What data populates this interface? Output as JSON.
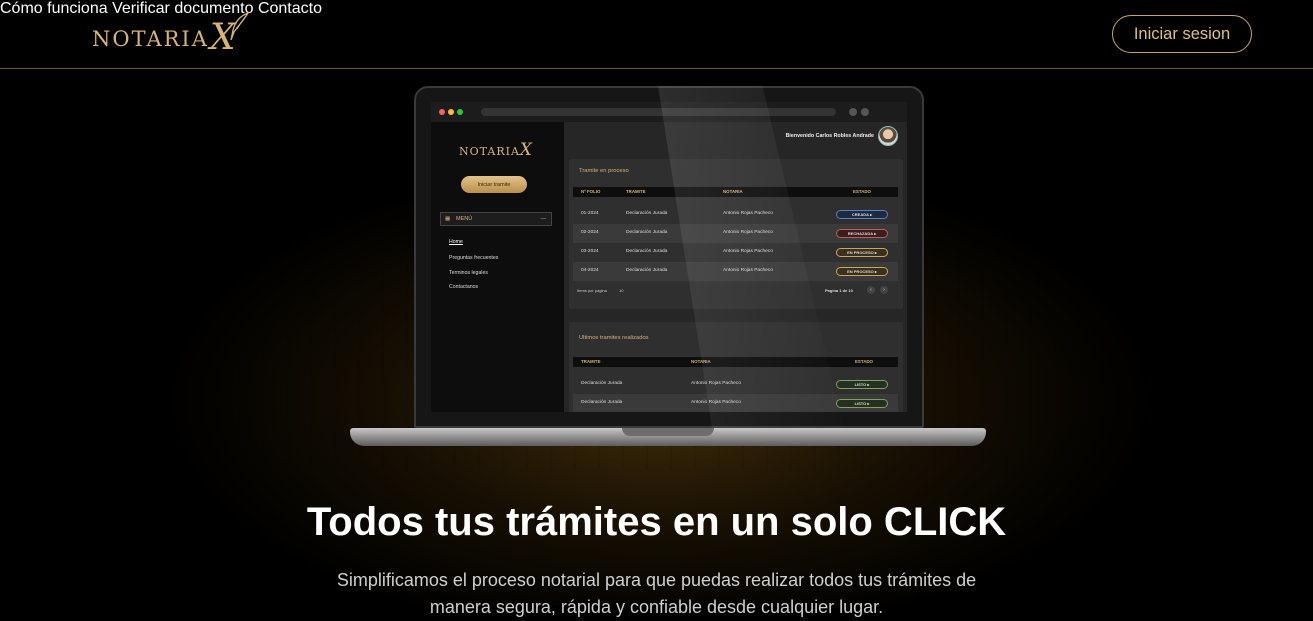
{
  "header": {
    "logo_text": "NOTARIA",
    "logo_x": "X",
    "nav": [
      "Cómo funciona",
      "Verificar documento",
      "Contacto"
    ],
    "login_label": "Iniciar sesion"
  },
  "colors": {
    "background": "#000000",
    "accent_gold": "#d7b474",
    "button_border": "#c8a56a",
    "status_creada": "#5b7fc2",
    "status_rechazada": "#c25b5b",
    "status_en_proceso": "#c9a65a",
    "status_listo": "#7fa35b"
  },
  "laptop_app": {
    "logo_text": "NOTARIA",
    "logo_x": "X",
    "start_button": "Iniciar tramite",
    "menu_label": "MENÚ",
    "menu_items": [
      "Home",
      "Preguntas frecuentes",
      "Terminos legales",
      "Contactanos"
    ],
    "welcome": "Bienvenido Carlos Robles Andrade",
    "in_process": {
      "title": "Tramite en proceso",
      "columns": [
        "Nº FOLIO",
        "TRAMITE",
        "NOTARIA",
        "ESTADO"
      ],
      "rows": [
        {
          "folio": "01-2024",
          "tramite": "Declaración Jurada",
          "notaria": "Antonio Rojas Pacheco",
          "estado": "CREADA"
        },
        {
          "folio": "02-2024",
          "tramite": "Declaración Jurada",
          "notaria": "Antonio Rojas Pacheco",
          "estado": "RECHAZADA"
        },
        {
          "folio": "03-2024",
          "tramite": "Declaración Jurada",
          "notaria": "Antonio Rojas Pacheco",
          "estado": "EN PROCESO"
        },
        {
          "folio": "04-2024",
          "tramite": "Declaración Jurada",
          "notaria": "Antonio Rojas Pacheco",
          "estado": "EN PROCESO"
        }
      ],
      "rows_per_page_label": "Items por pagina",
      "rows_per_page_value": "10",
      "pagination": "Pagina 1 de 10"
    },
    "completed": {
      "title": "Ultimos tramites realizados",
      "columns": [
        "TRAMITE",
        "NOTARIA",
        "ESTADO"
      ],
      "rows": [
        {
          "tramite": "Declaración Jurada",
          "notaria": "Antonio Rojas Pacheco",
          "estado": "LISTO"
        },
        {
          "tramite": "Declaración Jurada",
          "notaria": "Antonio Rojas Pacheco",
          "estado": "LISTO"
        }
      ]
    }
  },
  "hero": {
    "title": "Todos tus trámites en un solo CLICK",
    "subtitle": "Simplificamos el proceso notarial para que puedas realizar todos tus trámites de manera segura, rápida y confiable desde cualquier lugar."
  }
}
